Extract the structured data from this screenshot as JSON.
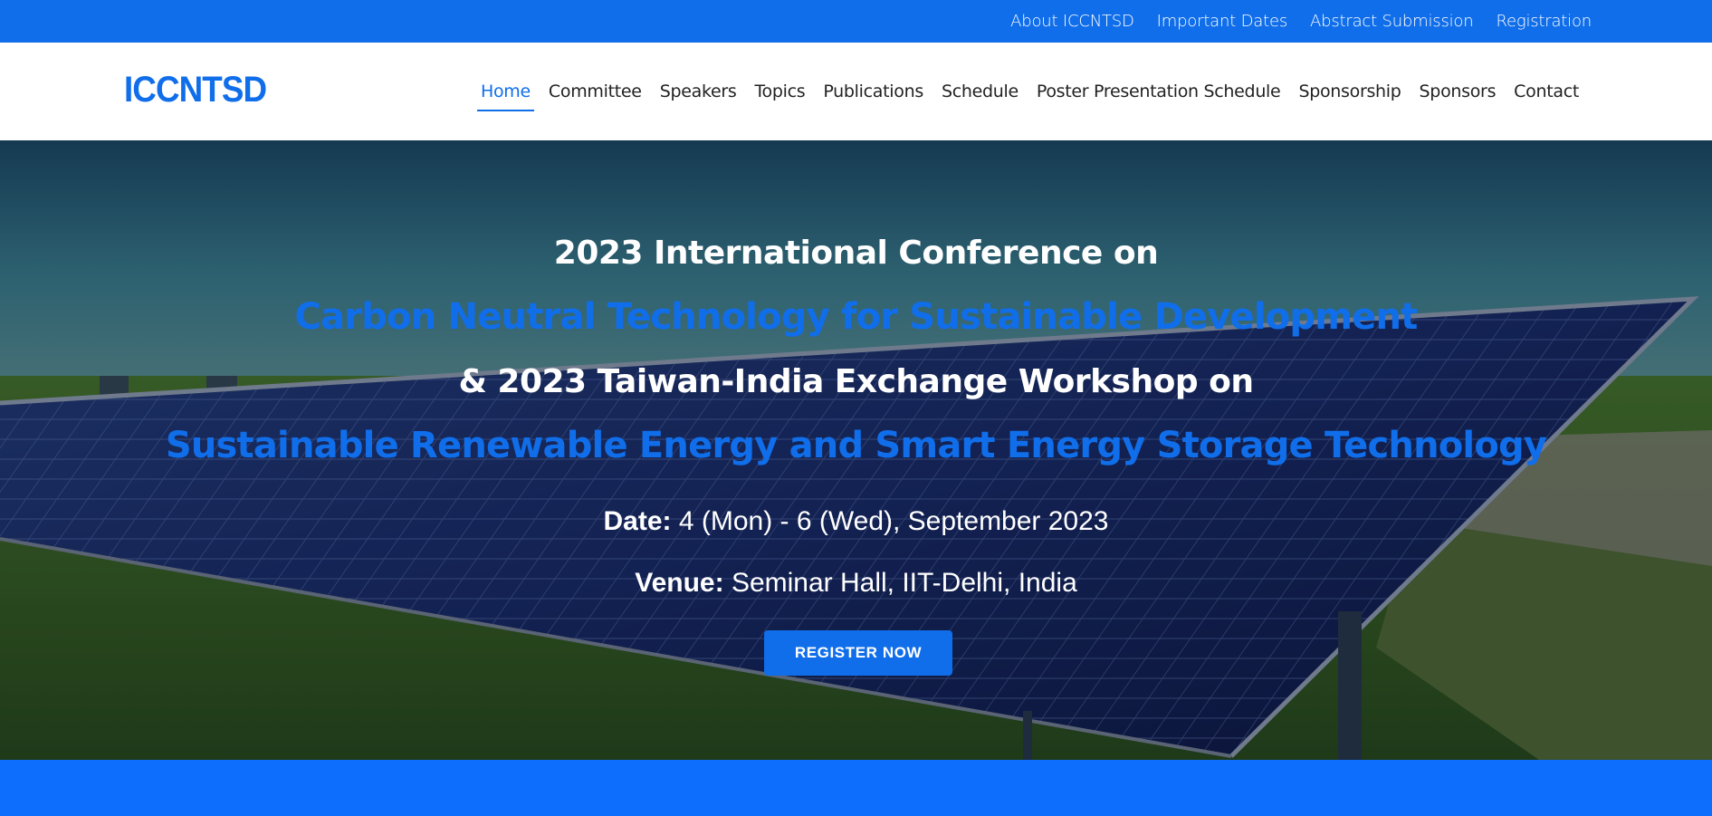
{
  "topbar": {
    "links": [
      "About ICCNTSD",
      "Important Dates",
      "Abstract Submission",
      "Registration"
    ]
  },
  "header": {
    "logo": "ICCNTSD",
    "nav": [
      {
        "label": "Home",
        "active": true
      },
      {
        "label": "Committee",
        "active": false
      },
      {
        "label": "Speakers",
        "active": false
      },
      {
        "label": "Topics",
        "active": false
      },
      {
        "label": "Publications",
        "active": false
      },
      {
        "label": "Schedule",
        "active": false
      },
      {
        "label": "Poster Presentation Schedule",
        "active": false
      },
      {
        "label": "Sponsorship",
        "active": false
      },
      {
        "label": "Sponsors",
        "active": false
      },
      {
        "label": "Contact",
        "active": false
      }
    ]
  },
  "hero": {
    "line1": "2023 International Conference on",
    "line2": "Carbon Neutral Technology for Sustainable Development",
    "line3": "& 2023 Taiwan-India Exchange Workshop on",
    "line4": "Sustainable Renewable Energy and Smart Energy Storage Technology",
    "date_label": "Date:",
    "date_value": " 4 (Mon) - 6 (Wed), September 2023",
    "venue_label": "Venue:",
    "venue_value": " Seminar Hall, IIT-Delhi, India",
    "register_button": "REGISTER NOW",
    "background": "solar-panel-field-image"
  },
  "colors": {
    "accent": "#106eea",
    "topbar": "#106eea",
    "bottom_band": "#0d6efd",
    "nav_text": "#222222"
  }
}
